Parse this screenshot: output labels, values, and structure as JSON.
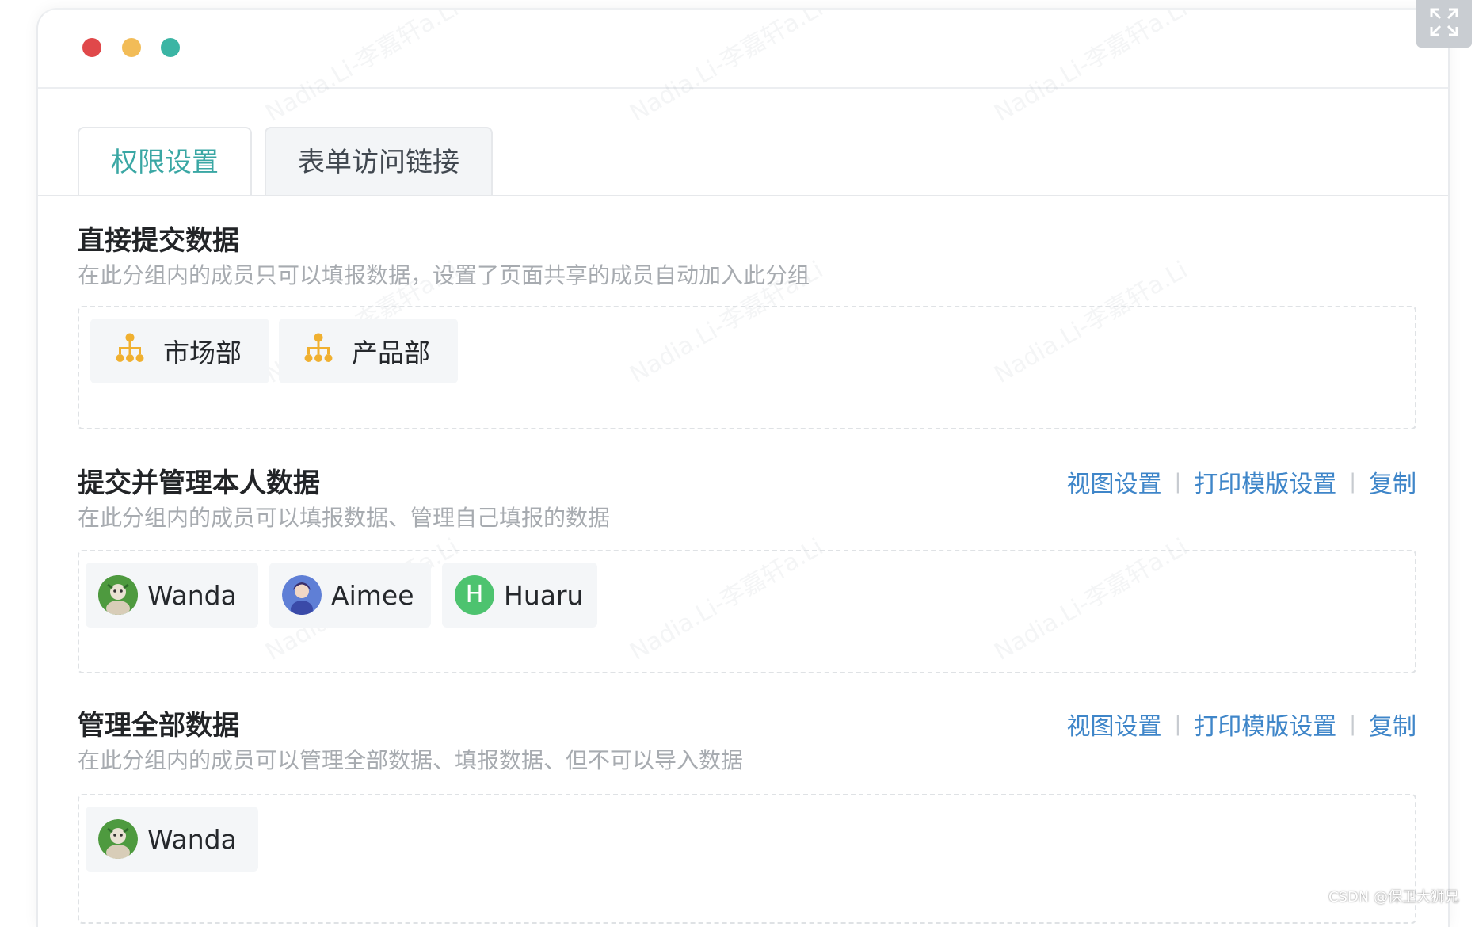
{
  "window": {
    "controls": [
      {
        "name": "close",
        "color": "#e0484a"
      },
      {
        "name": "minimize",
        "color": "#f2bc57"
      },
      {
        "name": "zoom",
        "color": "#3bb5a4"
      }
    ]
  },
  "tabs": [
    {
      "label": "权限设置",
      "active": true
    },
    {
      "label": "表单访问链接",
      "active": false
    }
  ],
  "sections": [
    {
      "title": "直接提交数据",
      "description": "在此分组内的成员只可以填报数据，设置了页面共享的成员自动加入此分组",
      "items": [
        {
          "type": "department",
          "label": "市场部",
          "icon": "org-chart-icon"
        },
        {
          "type": "department",
          "label": "产品部",
          "icon": "org-chart-icon"
        }
      ]
    },
    {
      "title": "提交并管理本人数据",
      "description": "在此分组内的成员可以填报数据、管理自己填报的数据",
      "actions": {
        "view": "视图设置",
        "print": "打印模版设置",
        "copy": "复制"
      },
      "items": [
        {
          "type": "member",
          "label": "Wanda",
          "avatar": "photo-green"
        },
        {
          "type": "member",
          "label": "Aimee",
          "avatar": "photo-blue"
        },
        {
          "type": "member",
          "label": "Huaru",
          "avatar": "letter",
          "letter": "H"
        }
      ]
    },
    {
      "title": "管理全部数据",
      "description": "在此分组内的成员可以管理全部数据、填报数据、但不可以导入数据",
      "actions": {
        "view": "视图设置",
        "print": "打印模版设置",
        "copy": "复制"
      },
      "items": [
        {
          "type": "member",
          "label": "Wanda",
          "avatar": "photo-green"
        }
      ]
    }
  ],
  "colors": {
    "accent": "#3aa7a4",
    "link": "#3f86c9",
    "org_icon": "#f0b030",
    "avatar_h": "#4dc36f"
  },
  "watermark": "Nadia.Li-李嘉轩a.Li",
  "credit": "CSDN @保卫大狮兄"
}
